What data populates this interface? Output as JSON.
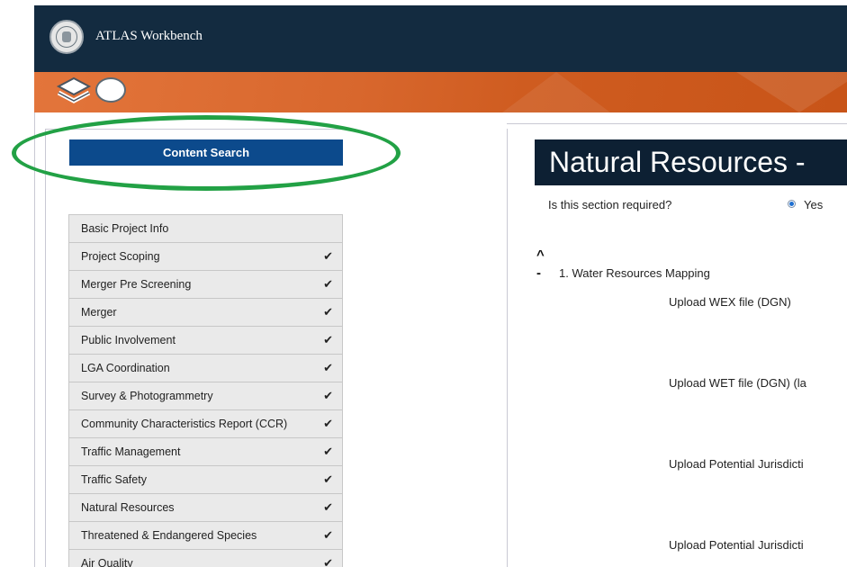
{
  "app": {
    "title": "ATLAS Workbench"
  },
  "sidebar": {
    "search_button": "Content Search",
    "items": [
      {
        "label": "Basic Project Info",
        "check": ""
      },
      {
        "label": "Project Scoping",
        "check": "✔"
      },
      {
        "label": "Merger Pre Screening",
        "check": "✔"
      },
      {
        "label": "Merger",
        "check": "✔"
      },
      {
        "label": "Public Involvement",
        "check": "✔"
      },
      {
        "label": "LGA Coordination",
        "check": "✔"
      },
      {
        "label": "Survey & Photogrammetry",
        "check": "✔"
      },
      {
        "label": "Community Characteristics Report (CCR)",
        "check": "✔"
      },
      {
        "label": "Traffic Management",
        "check": "✔"
      },
      {
        "label": "Traffic Safety",
        "check": "✔"
      },
      {
        "label": "Natural Resources",
        "check": "✔"
      },
      {
        "label": "Threatened & Endangered Species",
        "check": "✔"
      },
      {
        "label": "Air Quality",
        "check": "✔"
      }
    ]
  },
  "main": {
    "section_title": "Natural Resources -",
    "required_question": "Is this section required?",
    "required_yes": "Yes",
    "collapse_icon": "^",
    "subsection_toggle": "-",
    "subsection_title": "1. Water Resources Mapping",
    "uploads": [
      "Upload WEX file (DGN)",
      "Upload WET file (DGN) (la",
      "Upload Potential Jurisdicti",
      "Upload Potential Jurisdicti"
    ]
  },
  "colors": {
    "header_bg": "#132b40",
    "banner_orange": "#d8672d",
    "search_button_bg": "#0c4a8c",
    "highlight_ellipse": "#22a145",
    "section_title_bg": "#0d2033"
  }
}
